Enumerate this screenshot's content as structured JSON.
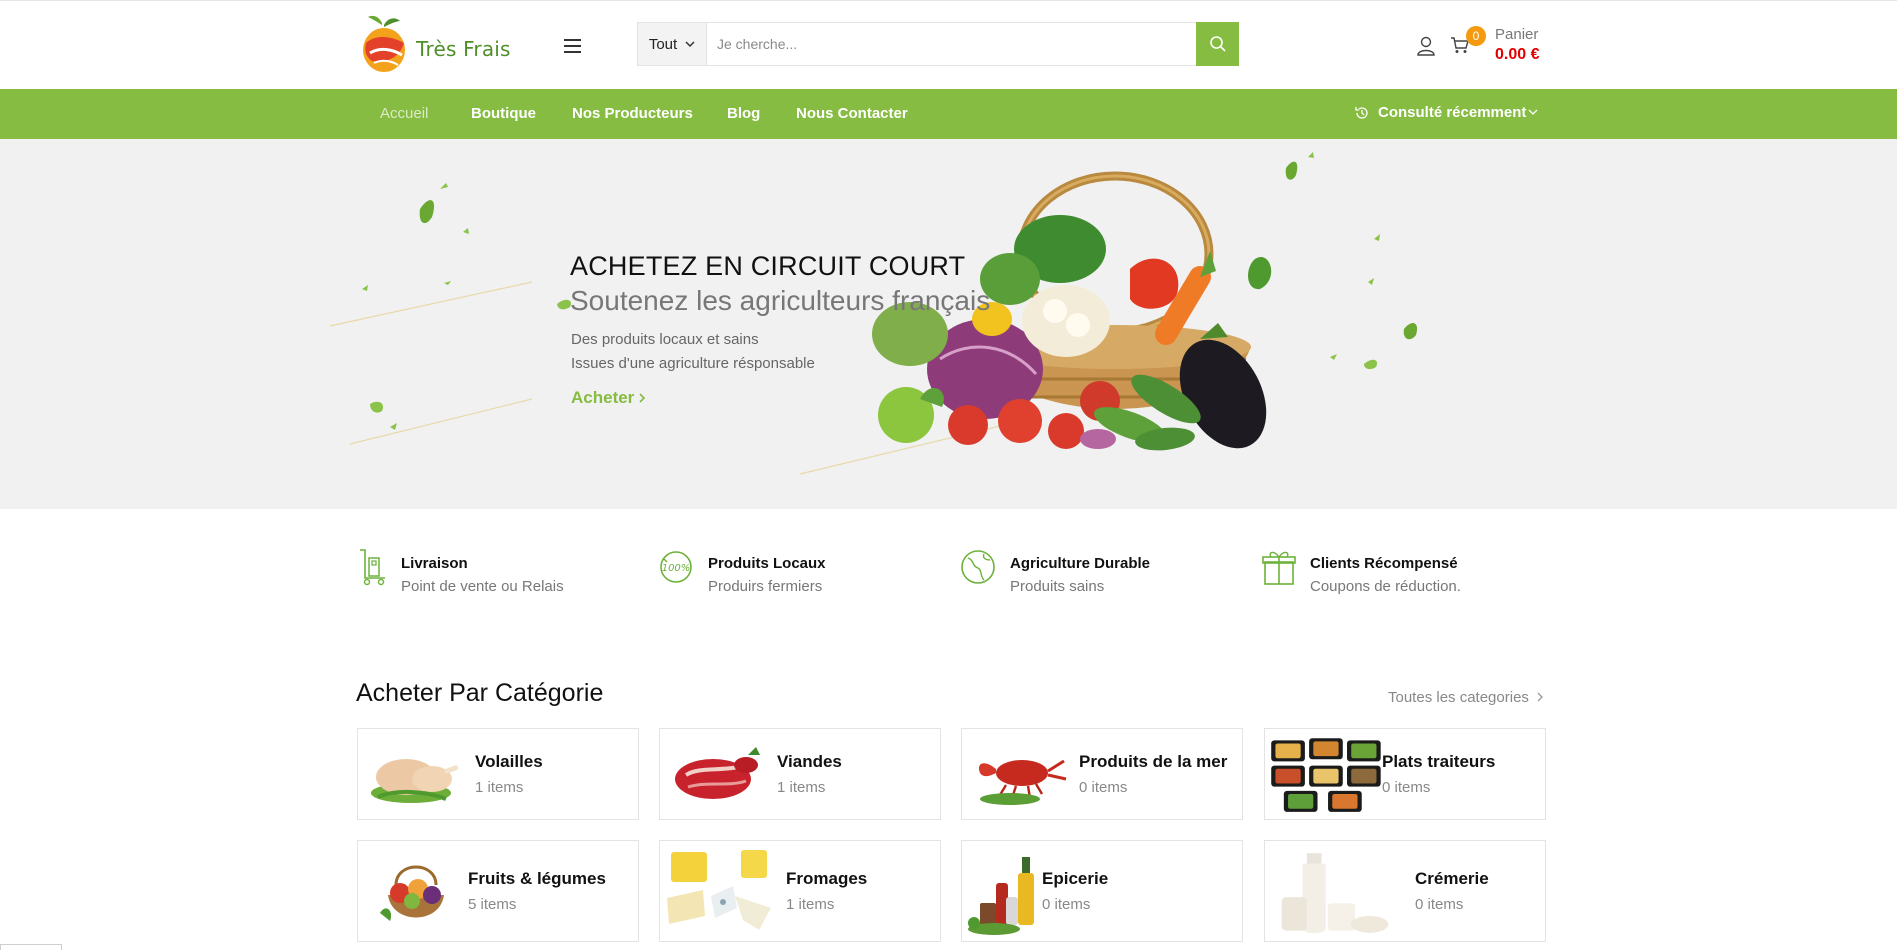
{
  "colors": {
    "accent": "#86bc42",
    "badge": "#f39a0e",
    "price": "#e10000",
    "hero_bg": "#f1f1f1"
  },
  "header": {
    "logo_text": "Très Frais",
    "search": {
      "category": "Tout",
      "placeholder": "Je cherche..."
    },
    "cart": {
      "count": "0",
      "label": "Panier",
      "total": "0.00 €"
    }
  },
  "nav": {
    "items": [
      "Accueil",
      "Boutique",
      "Nos Producteurs",
      "Blog",
      "Nous Contacter"
    ],
    "active": "Accueil",
    "recent_label": "Consulté récemment"
  },
  "hero": {
    "title": "ACHETEZ EN CIRCUIT COURT",
    "subtitle": "Soutenez les agriculteurs français",
    "line1": "Des produits locaux et sains",
    "line2": "Issues d'une agriculture résponsable",
    "cta": "Acheter"
  },
  "features": [
    {
      "icon": "delivery-trolley-icon",
      "title": "Livraison",
      "subtitle": "Point de vente ou Relais"
    },
    {
      "icon": "100-percent-icon",
      "title": "Produits Locaux",
      "subtitle": "Produirs fermiers"
    },
    {
      "icon": "globe-icon",
      "title": "Agriculture Durable",
      "subtitle": "Produits sains"
    },
    {
      "icon": "gift-icon",
      "title": "Clients Récompensé",
      "subtitle": "Coupons de réduction."
    }
  ],
  "categories": {
    "title": "Acheter Par Catégorie",
    "all_link": "Toutes les categories",
    "items": [
      {
        "name": "Volailles",
        "count": "1 items"
      },
      {
        "name": "Viandes",
        "count": "1 items"
      },
      {
        "name": "Produits de la mer",
        "count": "0 items"
      },
      {
        "name": "Plats traiteurs",
        "count": "0 items"
      },
      {
        "name": "Fruits & légumes",
        "count": "5 items"
      },
      {
        "name": "Fromages",
        "count": "1 items"
      },
      {
        "name": "Epicerie",
        "count": "0 items"
      },
      {
        "name": "Crémerie",
        "count": "0 items"
      }
    ]
  }
}
